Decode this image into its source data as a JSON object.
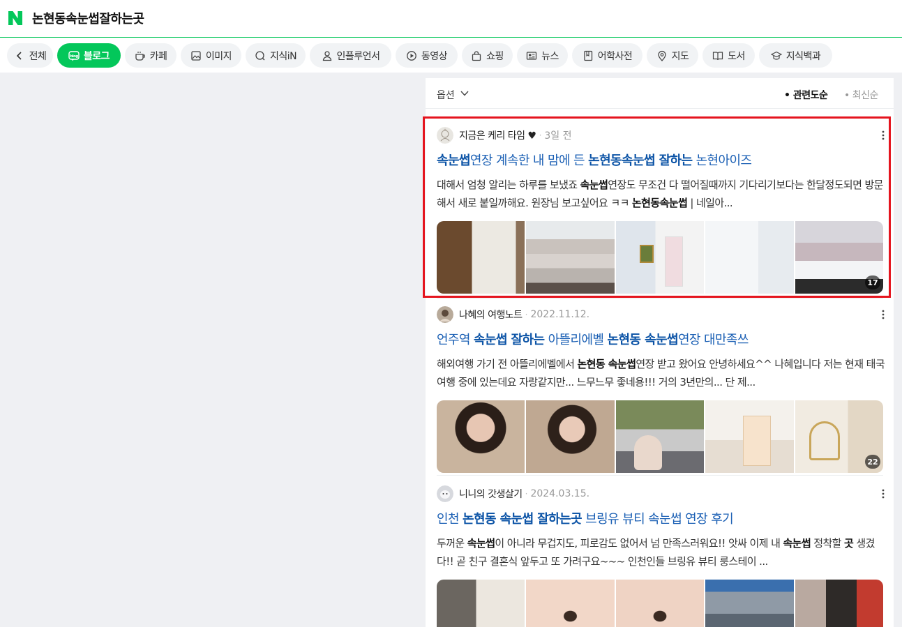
{
  "header": {
    "query": "논현동속눈썹잘하는곳"
  },
  "tabs": [
    {
      "label": "전체",
      "icon": "chevron-left-icon"
    },
    {
      "label": "블로그",
      "icon": "blog-icon",
      "active": true
    },
    {
      "label": "카페",
      "icon": "cafe-cup-icon"
    },
    {
      "label": "이미지",
      "icon": "image-icon"
    },
    {
      "label": "지식iN",
      "icon": "question-bubble-icon"
    },
    {
      "label": "인플루언서",
      "icon": "person-icon"
    },
    {
      "label": "동영상",
      "icon": "play-circle-icon"
    },
    {
      "label": "쇼핑",
      "icon": "shopping-bag-icon"
    },
    {
      "label": "뉴스",
      "icon": "news-icon"
    },
    {
      "label": "어학사전",
      "icon": "dictionary-icon"
    },
    {
      "label": "지도",
      "icon": "map-pin-icon"
    },
    {
      "label": "도서",
      "icon": "book-icon"
    },
    {
      "label": "지식백과",
      "icon": "graduation-cap-icon"
    }
  ],
  "options": {
    "label": "옵션",
    "sort_relevance": "• 관련도순",
    "sort_recent": "• 최신순"
  },
  "colors": {
    "naver_green": "#03c75a",
    "title_blue": "#1a5fb4",
    "highlight_red": "#e5141e"
  },
  "posts": [
    {
      "author": "지금은 케리 타임 ♥",
      "date": "3일 전",
      "title_parts": [
        {
          "text": "속눈썹",
          "bold": true
        },
        {
          "text": "연장 계속한 내 맘에 든 ",
          "bold": false
        },
        {
          "text": "논현동속눈썹 잘하는",
          "bold": true
        },
        {
          "text": " 논현아이즈",
          "bold": false
        }
      ],
      "desc_parts": [
        {
          "text": "대해서 엄청 알리는 하루를 보냈죠 ",
          "bold": false
        },
        {
          "text": "속눈썹",
          "bold": true
        },
        {
          "text": "연장도 무조건 다 떨어질때까지 기다리기보다는 한달정도되면 방문해서 새로 붙일까해요. 원장님 보고싶어요 ㅋㅋ ",
          "bold": false
        },
        {
          "text": "논현동속눈썹",
          "bold": true
        },
        {
          "text": " | 네일아...",
          "bold": false
        }
      ],
      "image_count": "17"
    },
    {
      "author": "나혜의 여행노트",
      "date": "2022.11.12.",
      "title_parts": [
        {
          "text": "언주역 ",
          "bold": false
        },
        {
          "text": "속눈썹 잘하는",
          "bold": true
        },
        {
          "text": " 아뜰리에벨 ",
          "bold": false
        },
        {
          "text": "논현동 속눈썹",
          "bold": true
        },
        {
          "text": "연장 대만족쓰",
          "bold": false
        }
      ],
      "desc_parts": [
        {
          "text": "해외여행 가기 전 아뜰리에벨에서 ",
          "bold": false
        },
        {
          "text": "논현동 속눈썹",
          "bold": true
        },
        {
          "text": "연장 받고 왔어요 안녕하세요^^ 나혜입니다 저는 현재 태국 여행 중에 있는데요 자랑같지만... 느무느무 좋네용!!! 거의 3년만의... 단 제...",
          "bold": false
        }
      ],
      "image_count": "22"
    },
    {
      "author": "니니의 갓생살기",
      "date": "2024.03.15.",
      "title_parts": [
        {
          "text": "인천 ",
          "bold": false
        },
        {
          "text": "논현동 속눈썹 잘하는곳",
          "bold": true
        },
        {
          "text": " 브링유 뷰티 속눈썹 연장 후기",
          "bold": false
        }
      ],
      "desc_parts": [
        {
          "text": "두꺼운 ",
          "bold": false
        },
        {
          "text": "속눈썹",
          "bold": true
        },
        {
          "text": "이 아니라 무겁지도, 피로감도 없어서 넘 만족스러워요!! 앗싸 이제 내 ",
          "bold": false
        },
        {
          "text": "속눈썹",
          "bold": true
        },
        {
          "text": " 정착할 ",
          "bold": false
        },
        {
          "text": "곳",
          "bold": true
        },
        {
          "text": " 생겼다!! 곧 친구 결혼식 앞두고 또 가려구요~~~ 인천인들 브링유 뷰티 룽스테이 ...",
          "bold": false
        }
      ],
      "image_count": ""
    }
  ]
}
